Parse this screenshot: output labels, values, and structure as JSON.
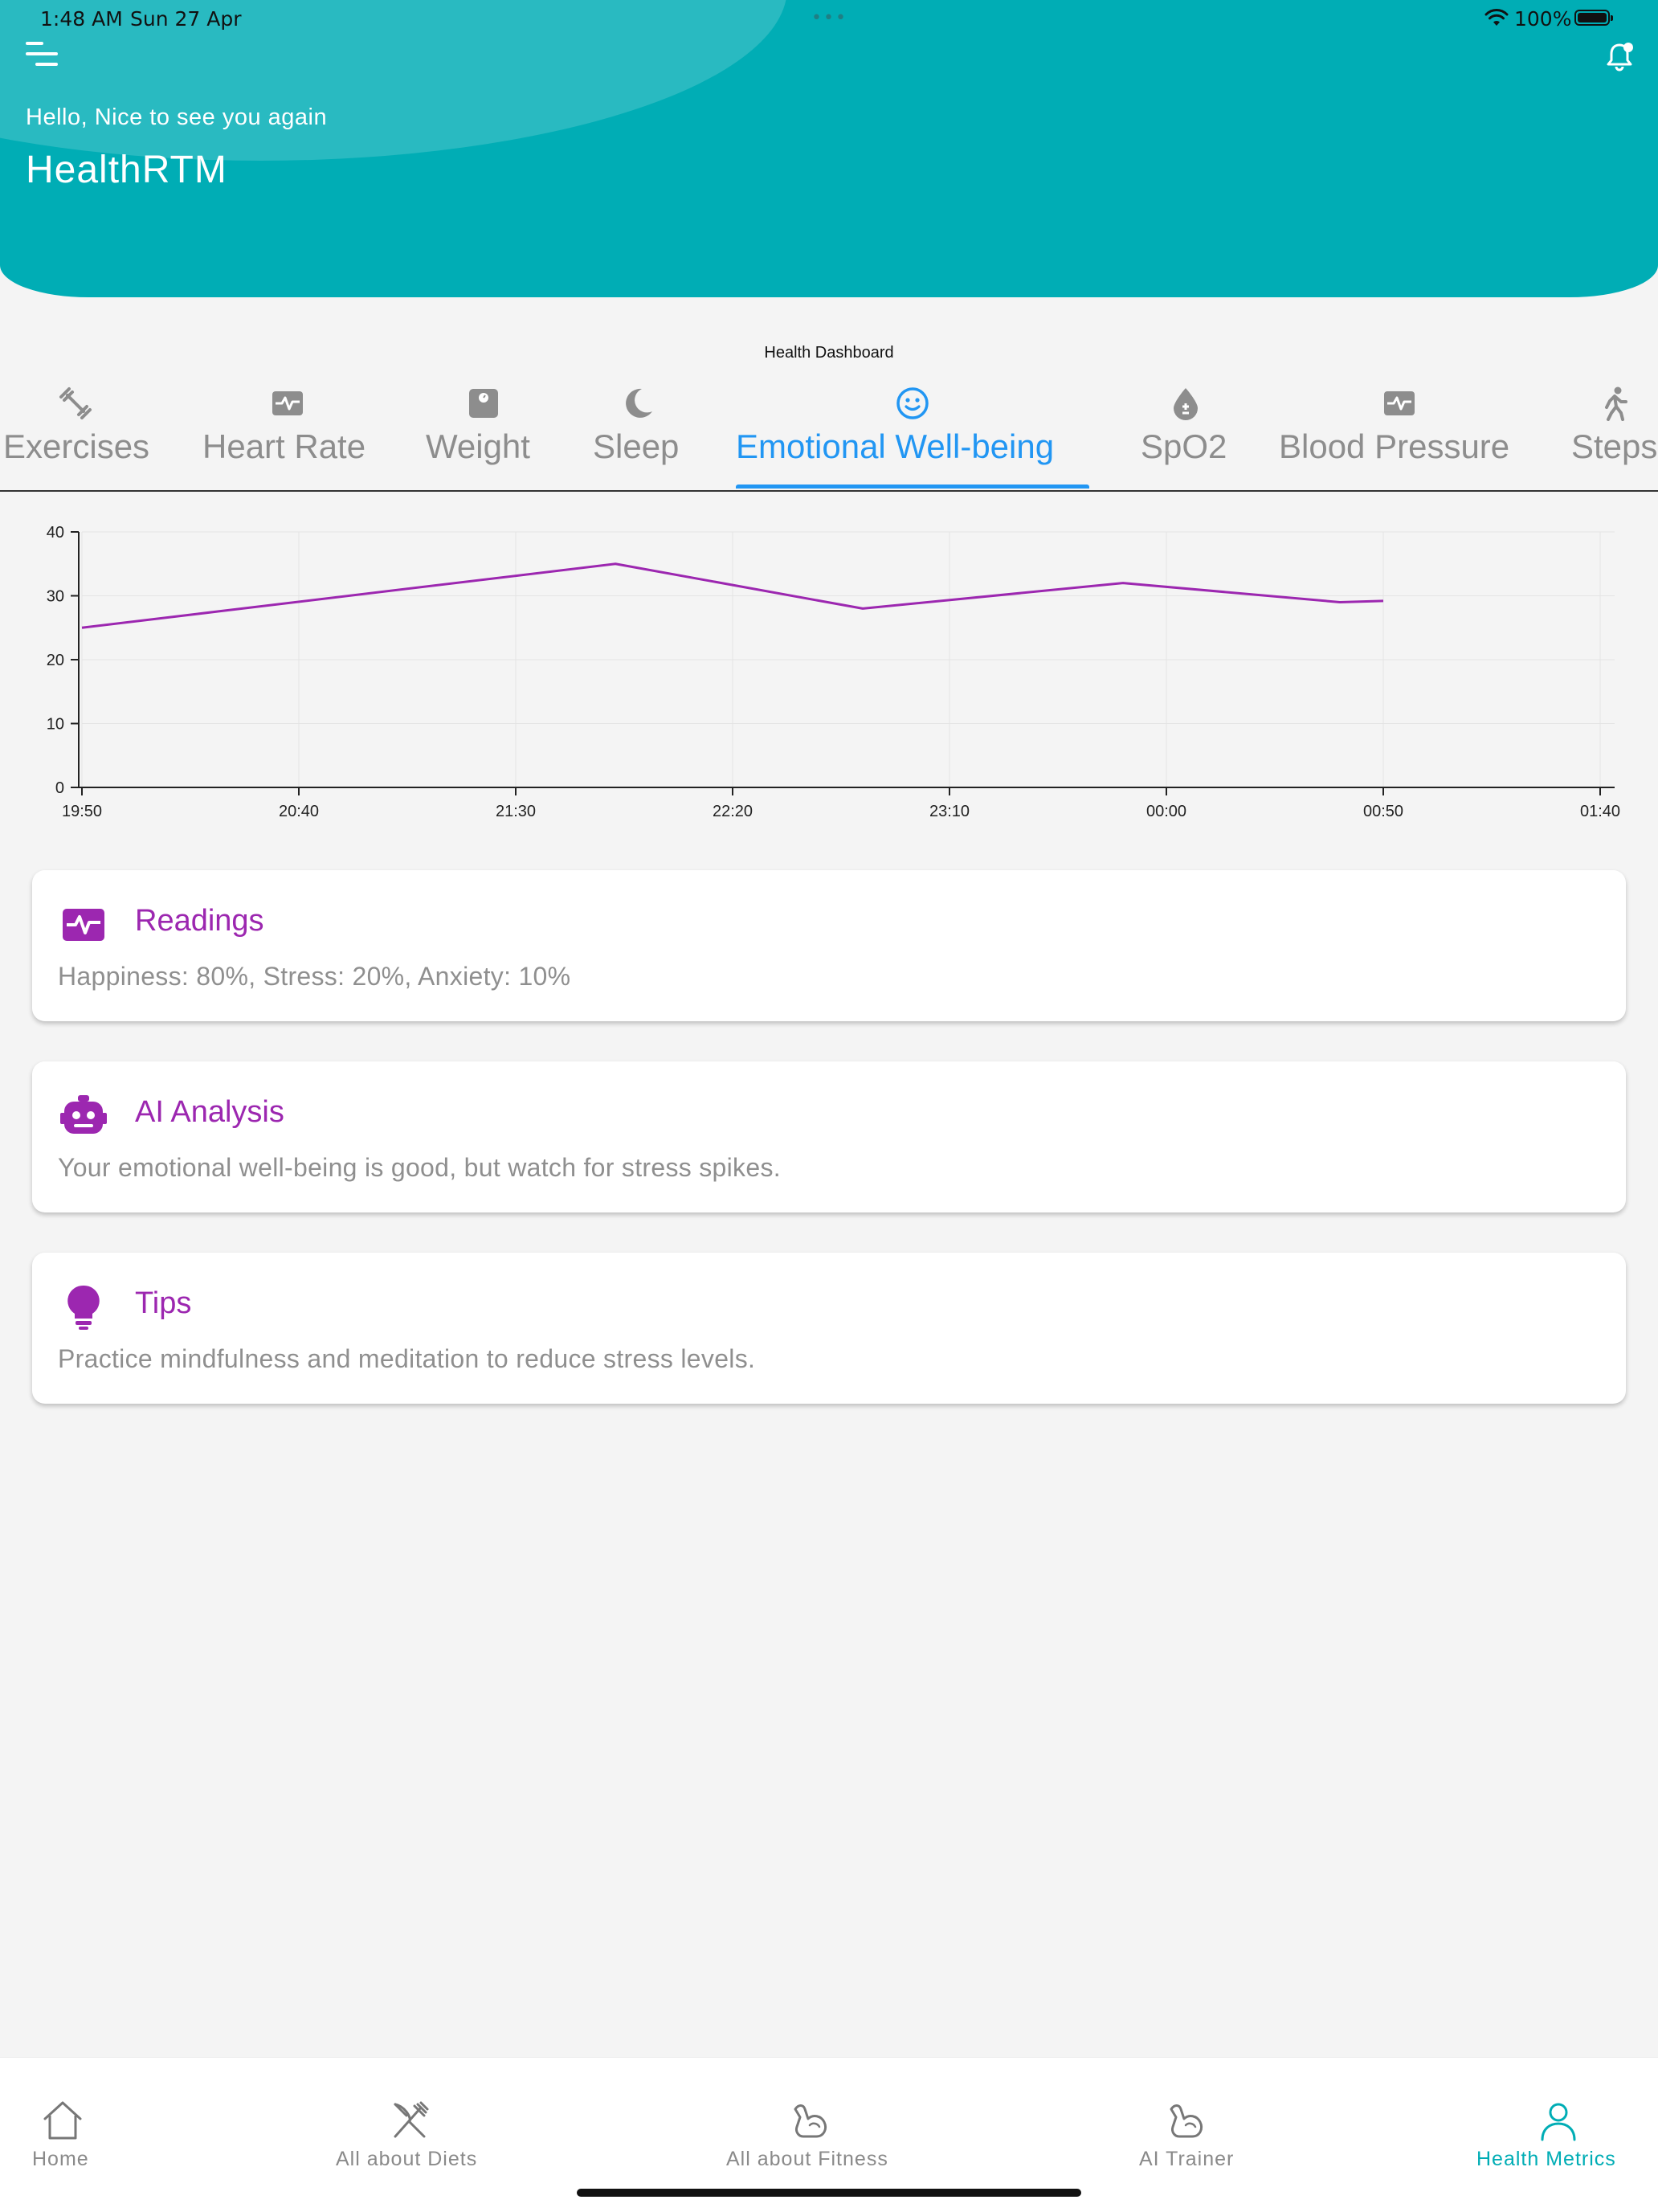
{
  "status_bar": {
    "time": "1:48 AM",
    "date": "Sun 27 Apr",
    "dots": "•••",
    "battery": "100%"
  },
  "header": {
    "greeting": "Hello, Nice to see you again",
    "title": "HealthRTM"
  },
  "dashboard": {
    "label": "Health Dashboard",
    "tabs": [
      {
        "label": "Exercises",
        "icon": "dumbbell-icon"
      },
      {
        "label": "Heart Rate",
        "icon": "heart-monitor-icon"
      },
      {
        "label": "Weight",
        "icon": "scale-icon"
      },
      {
        "label": "Sleep",
        "icon": "moon-icon"
      },
      {
        "label": "Emotional Well-being",
        "icon": "smiley-icon",
        "active": true
      },
      {
        "label": "SpO2",
        "icon": "drop-icon"
      },
      {
        "label": "Blood Pressure",
        "icon": "monitor-pulse-icon"
      },
      {
        "label": "Steps",
        "icon": "walking-icon"
      }
    ]
  },
  "chart_data": {
    "type": "line",
    "x": [
      "19:50",
      "21:53",
      "22:50",
      "23:50",
      "00:40",
      "00:50"
    ],
    "series": [
      {
        "values": [
          25,
          35,
          28,
          32,
          29,
          29.2
        ],
        "color": "#9c27b0"
      }
    ],
    "xticks": [
      "19:50",
      "20:40",
      "21:30",
      "22:20",
      "23:10",
      "00:00",
      "00:50",
      "01:40"
    ],
    "yticks": [
      0,
      10,
      20,
      30,
      40
    ],
    "ylim": [
      0,
      40
    ],
    "xlim": [
      "19:50",
      "01:40"
    ],
    "grid": true
  },
  "cards": [
    {
      "title": "Readings",
      "body": "Happiness: 80%, Stress: 20%, Anxiety: 10%",
      "icon": "heart-monitor-icon"
    },
    {
      "title": "AI Analysis",
      "body": "Your emotional well-being is good, but watch for stress spikes.",
      "icon": "robot-icon"
    },
    {
      "title": "Tips",
      "body": "Practice mindfulness and meditation to reduce stress levels.",
      "icon": "lightbulb-icon"
    }
  ],
  "bottom_nav": [
    {
      "label": "Home",
      "icon": "home-icon"
    },
    {
      "label": "All about Diets",
      "icon": "fork-knife-icon"
    },
    {
      "label": "All about Fitness",
      "icon": "flexed-arm-icon"
    },
    {
      "label": "AI Trainer",
      "icon": "flexed-arm-icon"
    },
    {
      "label": "Health Metrics",
      "icon": "person-icon",
      "active": true
    }
  ],
  "colors": {
    "header": "#00adb5",
    "accent_tab": "#2196f3",
    "card_accent": "#9c27b0",
    "nav_active": "#00adb5"
  }
}
